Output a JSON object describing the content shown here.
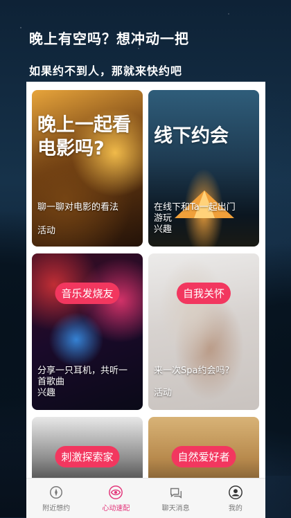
{
  "header": {
    "title": "晚上有空吗？想冲动一把",
    "subtitle": "如果约不到人，那就来快约吧"
  },
  "cards": [
    {
      "title": "晚上一起看电影吗?",
      "desc_lines": [
        "聊一聊对电影的看法"
      ],
      "tag": "活动"
    },
    {
      "title": "线下约会",
      "desc_lines": [
        "在线下和Ta一起出门",
        "游玩"
      ],
      "tag": "兴趣"
    },
    {
      "pill": "音乐发烧友",
      "desc_lines": [
        "分享一只耳机，共听一",
        "首歌曲"
      ],
      "tag": "兴趣"
    },
    {
      "pill": "自我关怀",
      "desc_lines": [
        "来一次Spa约会吗?"
      ],
      "tag": "活动"
    },
    {
      "pill": "刺激探索家"
    },
    {
      "pill": "自然爱好者"
    }
  ],
  "tabbar": {
    "items": [
      {
        "label": "附近想约",
        "icon": "compass-icon"
      },
      {
        "label": "心动速配",
        "icon": "eye-icon",
        "active": true
      },
      {
        "label": "聊天消息",
        "icon": "chat-icon"
      },
      {
        "label": "我的",
        "icon": "user-icon"
      }
    ]
  },
  "colors": {
    "accent": "#f2375f",
    "active_tab": "#e3357a"
  }
}
